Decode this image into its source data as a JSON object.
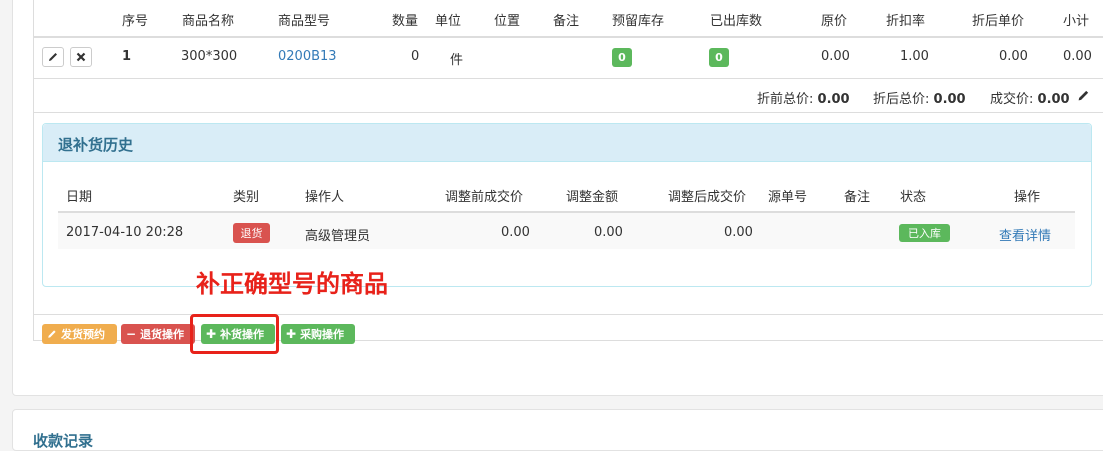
{
  "table": {
    "headers": [
      "序号",
      "商品名称",
      "商品型号",
      "数量",
      "单位",
      "位置",
      "备注",
      "预留库存",
      "已出库数",
      "原价",
      "折扣率",
      "折后单价",
      "小计"
    ],
    "row": {
      "index": "1",
      "name": "300*300",
      "model": "0200B13",
      "qty": "0",
      "unit": "件",
      "reserved": "0",
      "shipped": "0",
      "orig_price": "0.00",
      "discount": "1.00",
      "unit_price": "0.00",
      "subtotal": "0.00"
    },
    "edit_icon": "pencil-icon",
    "delete_icon": "close-icon"
  },
  "totals": {
    "before_label": "折前总价:",
    "before_value": "0.00",
    "after_label": "折后总价:",
    "after_value": "0.00",
    "deal_label": "成交价:",
    "deal_value": "0.00"
  },
  "history": {
    "title": "退补货历史",
    "headers": [
      "日期",
      "类别",
      "操作人",
      "调整前成交价",
      "调整金额",
      "调整后成交价",
      "源单号",
      "备注",
      "状态",
      "操作"
    ],
    "row": {
      "date": "2017-04-10 20:28",
      "type": "退货",
      "operator": "高级管理员",
      "before": "0.00",
      "amount": "0.00",
      "after": "0.00",
      "status": "已入库",
      "action": "查看详情"
    }
  },
  "annotation": "补正确型号的商品",
  "buttons": {
    "ship": "发货预约",
    "return": "退货操作",
    "restock": "补货操作",
    "purchase": "采购操作"
  },
  "colors": {
    "green": "#5cb85c",
    "red": "#d9534f",
    "orange": "#f0ad4e",
    "link": "#337ab7",
    "annotation_red": "#e8221a"
  },
  "bottom": {
    "title": "收款记录"
  }
}
